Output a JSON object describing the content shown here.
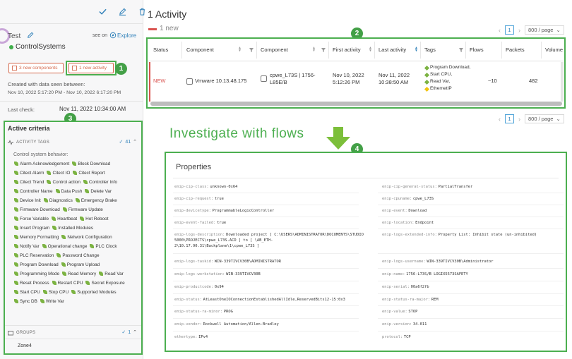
{
  "left": {
    "site_name": "Test",
    "site_sub": "ControlSystems",
    "see_on": "see on",
    "explore": "Explore",
    "chip_components": "3 new components",
    "chip_activity": "1 new activity",
    "created_label": "Created with data seen between:",
    "created_range": "Nov 10, 2022 5:17:20 PM - Nov 10, 2022 6:17:20 PM",
    "last_check_label": "Last check:",
    "last_check_value": "Nov 11, 2022 10:34:00 AM",
    "criteria": {
      "title": "Active criteria",
      "tags_label": "ACTIVITY TAGS",
      "tags_count": "41",
      "subtitle": "Control system behavior:",
      "tags": [
        "Alarm Acknowledgement",
        "Block Download",
        "Citect Alarm",
        "Citect IO",
        "Citect Report",
        "Citect Trend",
        "Control action",
        "Controller Info",
        "Controller Name",
        "Data Push",
        "Delete Var",
        "Device Init",
        "Diagnostics",
        "Emergency Brake",
        "Firmware Download",
        "Firmware Update",
        "Force Variable",
        "Heartbeat",
        "Hot Reboot",
        "Insert Program",
        "Installed Modules",
        "Memory Formatting",
        "Network Configuration",
        "Notify Var",
        "Operational change",
        "PLC Clock",
        "PLC Reservation",
        "Password Change",
        "Program Download",
        "Program Upload",
        "Programming Mode",
        "Read Memory",
        "Read Var",
        "Reset Process",
        "Restart CPU",
        "Secret Exposure",
        "Start CPU",
        "Stop CPU",
        "Supported Modules",
        "Sync DB",
        "Write Var"
      ],
      "groups_label": "GROUPS",
      "groups_count": "1",
      "group": "Zone4"
    }
  },
  "main": {
    "title": "1 Activity",
    "new_label": "1 new",
    "pager": {
      "page": "1",
      "per_page": "800 / page",
      "prev": "‹",
      "next": "›"
    },
    "columns": [
      "Status",
      "Component",
      "Component",
      "First activity",
      "Last activity",
      "Tags",
      "Flows",
      "Packets",
      "Volume"
    ],
    "row": {
      "status": "NEW",
      "component1": "Vmware 10.13.48.175",
      "component2_line1": "cpwe_L73S | 1756-",
      "component2_line2": "L85E/B",
      "first_line1": "Nov 10, 2022",
      "first_line2": "5:12:26 PM",
      "last_line1": "Nov 11, 2022",
      "last_line2": "10:38:50 AM",
      "tags": [
        "Program Download,",
        "Start CPU,",
        "Read Var,",
        "EthernetIP"
      ],
      "flows": "~10",
      "packets": "482"
    },
    "investigate": "Investigate with flows",
    "badges": [
      "1",
      "2",
      "3",
      "4"
    ],
    "properties": {
      "title": "Properties",
      "left": [
        {
          "k": "enip-cip-class:",
          "v": "unknown-0x64"
        },
        {
          "k": "enip-cip-request:",
          "v": "true"
        },
        {
          "k": "enip-devicetype:",
          "v": "ProgrammableLogicController"
        },
        {
          "k": "enip-event-failed:",
          "v": "true"
        },
        {
          "k": "enip-logs-description:",
          "v": "Downloaded project [ C:\\USERS\\ADMINISTRATOR\\DOCUMENTS\\STUDIO"
        },
        {
          "k": "",
          "v": "5000\\PROJECTS\\cpwe_L73S.ACD ] to [ \\AB_ETH-"
        },
        {
          "k": "",
          "v": "2\\10.17.90.31\\Backplane\\1\\cpwe_L73S ]"
        },
        {
          "k": "enip-logs-taskid:",
          "v": "WIN-339TIVCV30B\\ADMINISTRATOR"
        },
        {
          "k": "enip-logs-workstation:",
          "v": "WIN-339TIVCV30B"
        },
        {
          "k": "enip-productcode:",
          "v": "0x94"
        },
        {
          "k": "enip-status:",
          "v": "AtLeastOneIOConnectionEstablishedAllIdle,ReservedBits12-15:0x3"
        },
        {
          "k": "enip-status-ra-minor:",
          "v": "PROG"
        },
        {
          "k": "enip-vendor:",
          "v": "Rockwell Automation/Allen-Bradley"
        },
        {
          "k": "ethertype:",
          "v": "IPv4"
        }
      ],
      "right": [
        {
          "k": "enip-cip-general-status:",
          "v": "PartialTransfer"
        },
        {
          "k": "enip-cpuname:",
          "v": "cpwe_L73S"
        },
        {
          "k": "enip-event:",
          "v": "Download"
        },
        {
          "k": "enip-location:",
          "v": "Endpoint"
        },
        {
          "k": "enip-logs-extended-info:",
          "v": "Property List: Inhibit state (un-inhibited)"
        },
        {
          "k": "enip-logs-username:",
          "v": "WIN-339TIVCV30B\\Administrator"
        },
        {
          "k": "enip-name:",
          "v": "1756-L73S/B LOGIX5573SAFETY"
        },
        {
          "k": "enip-serial:",
          "v": "00a6f2fb"
        },
        {
          "k": "enip-status-ra-major:",
          "v": "REM"
        },
        {
          "k": "enip-value:",
          "v": "STOP"
        },
        {
          "k": "enip-version:",
          "v": "34.011"
        },
        {
          "k": "protocol:",
          "v": "TCP"
        }
      ]
    }
  },
  "colors": {
    "accent": "#4caf50",
    "link": "#2d7fb8",
    "new": "#d9534f",
    "chip": "#d4684c"
  }
}
